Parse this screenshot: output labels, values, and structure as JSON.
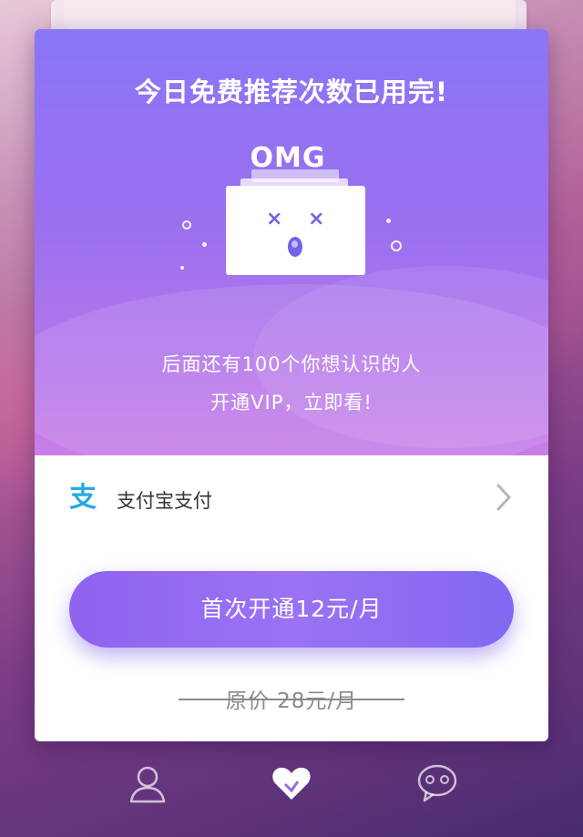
{
  "card": {
    "title": "今日免费推荐次数已用完!",
    "illustration": {
      "omg_text": "OMG",
      "icon": "omg-box-surprised-icon"
    },
    "message_line1": "后面还有100个你想认识的人",
    "message_line2": "开通VIP，立即看!"
  },
  "payment": {
    "method_label": "支付宝支付",
    "method_icon": "alipay-icon",
    "chevron_icon": "chevron-right-icon"
  },
  "cta": {
    "label": "首次开通12元/月"
  },
  "original_price": {
    "label": "原价  28元/月"
  },
  "tabbar": {
    "items": [
      {
        "name": "profile",
        "icon": "person-icon",
        "active": false
      },
      {
        "name": "likes",
        "icon": "heart-icon",
        "active": true
      },
      {
        "name": "chat",
        "icon": "chat-bubble-icon",
        "active": false
      }
    ]
  },
  "colors": {
    "accent": "#8f63ef",
    "alipay": "#29a8e6",
    "card_gradient_top": "#8a76f6",
    "card_gradient_bottom": "#c77ee8"
  }
}
